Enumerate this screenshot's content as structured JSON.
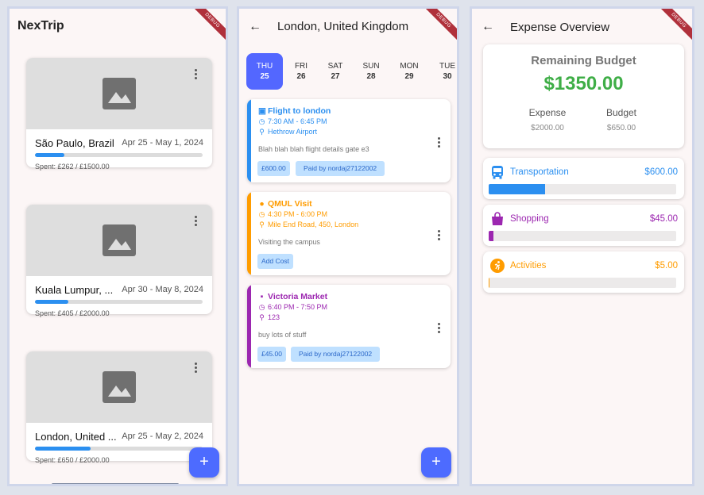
{
  "trips_screen": {
    "app_title": "NexTrip",
    "trips": [
      {
        "name": "São Paulo, Brazil",
        "dates": "Apr 25 - May 1, 2024",
        "spent_text": "Spent: £262 / £1500.00",
        "progress": 0.175
      },
      {
        "name": "Kuala Lumpur, ...",
        "dates": "Apr 30 - May 8, 2024",
        "spent_text": "Spent: £405 / £2000.00",
        "progress": 0.2
      },
      {
        "name": "London, United ...",
        "dates": "Apr 25 - May 2, 2024",
        "spent_text": "Spent: £650 / £2000.00",
        "progress": 0.33
      }
    ],
    "fab_label": "+"
  },
  "itinerary_screen": {
    "back_icon": "←",
    "title": "London, United Kingdom",
    "days": [
      {
        "dow": "THU",
        "num": "25",
        "selected": true
      },
      {
        "dow": "FRI",
        "num": "26",
        "selected": false
      },
      {
        "dow": "SAT",
        "num": "27",
        "selected": false
      },
      {
        "dow": "SUN",
        "num": "28",
        "selected": false
      },
      {
        "dow": "MON",
        "num": "29",
        "selected": false
      },
      {
        "dow": "TUE",
        "num": "30",
        "selected": false
      }
    ],
    "events": [
      {
        "title": "Flight to london",
        "time": "7:30 AM - 6:45 PM",
        "location": "Hethrow Airport",
        "description": "Blah blah blah flight details gate e3",
        "chips": [
          "£600.00",
          "Paid by nordaj27122002"
        ],
        "color": "#2b8ff0",
        "icon": "train-icon"
      },
      {
        "title": "QMUL Visit",
        "time": "4:30 PM - 6:00 PM",
        "location": "Mile End Road, 450, London",
        "description": "Visiting the campus",
        "chips": [
          "Add Cost"
        ],
        "color": "#ff9c00",
        "icon": "info-icon"
      },
      {
        "title": "Victoria Market",
        "time": "6:40 PM - 7:50 PM",
        "location": "123",
        "description": "buy lots of stuff",
        "chips": [
          "£45.00",
          "Paid by nordaj27122002"
        ],
        "color": "#9c27b0",
        "icon": "shopping-bag-icon"
      }
    ],
    "fab_label": "+"
  },
  "expense_screen": {
    "back_icon": "←",
    "title": "Expense Overview",
    "remaining_label": "Remaining Budget",
    "remaining_amount": "$1350.00",
    "expense_label": "Expense",
    "expense_value": "$2000.00",
    "budget_label": "Budget",
    "budget_value": "$650.00",
    "categories": [
      {
        "name": "Transportation",
        "amount": "$600.00",
        "color": "#2b8ff0",
        "icon": "bus-icon",
        "progress": 0.3
      },
      {
        "name": "Shopping",
        "amount": "$45.00",
        "color": "#9c27b0",
        "icon": "shopping-bag-icon",
        "progress": 0.025
      },
      {
        "name": "Activities",
        "amount": "$5.00",
        "color": "#ff9c00",
        "icon": "running-icon",
        "progress": 0.004
      }
    ]
  },
  "debug_banner": "DEBUG"
}
